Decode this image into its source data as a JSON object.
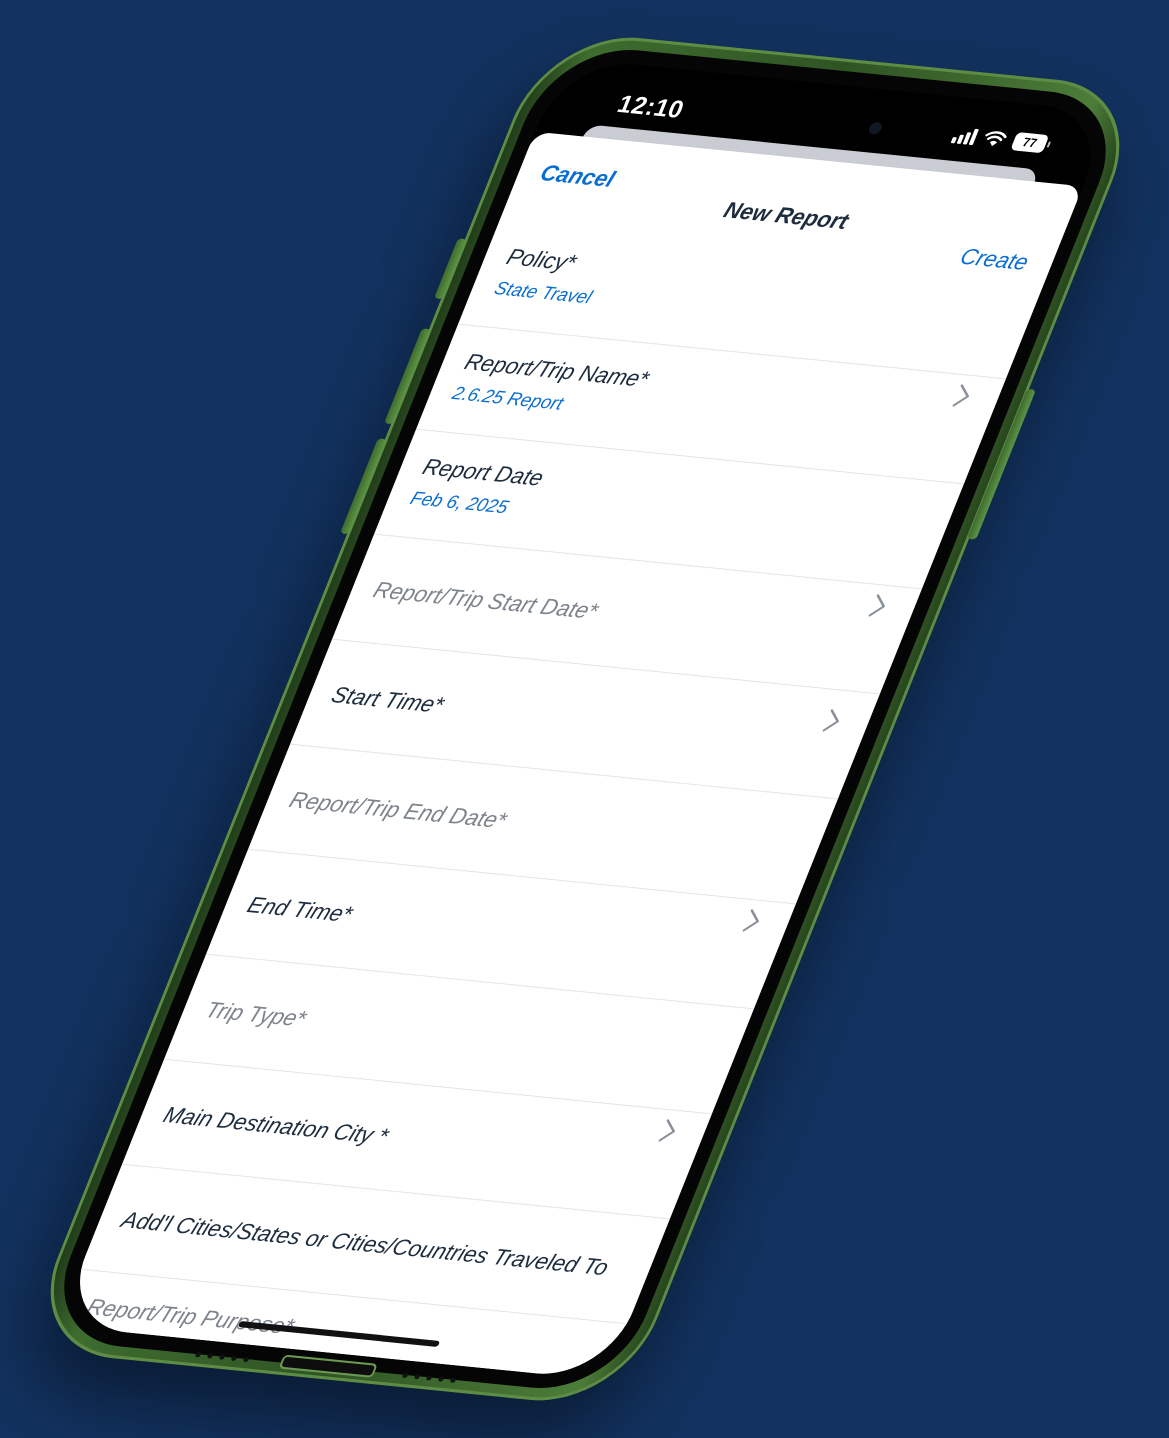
{
  "status_bar": {
    "time": "12:10",
    "battery": "77",
    "signal_icon": "cellular-signal-icon",
    "wifi_icon": "wifi-icon",
    "battery_icon": "battery-icon"
  },
  "navbar": {
    "cancel_label": "Cancel",
    "title": "New Report",
    "create_label": "Create"
  },
  "form": {
    "fields": [
      {
        "label": "Policy*",
        "value": "State Travel",
        "placeholder": false,
        "chevron": false
      },
      {
        "label": "Report/Trip Name*",
        "value": "2.6.25 Report",
        "placeholder": false,
        "chevron": true
      },
      {
        "label": "Report Date",
        "value": "Feb 6, 2025",
        "placeholder": false,
        "chevron": false
      },
      {
        "label": "Report/Trip Start Date*",
        "value": "",
        "placeholder": true,
        "chevron": true
      },
      {
        "label": "Start Time*",
        "value": "",
        "placeholder": false,
        "chevron": true
      },
      {
        "label": "Report/Trip  End Date*",
        "value": "",
        "placeholder": true,
        "chevron": false
      },
      {
        "label": "End Time*",
        "value": "",
        "placeholder": false,
        "chevron": true
      },
      {
        "label": "Trip Type*",
        "value": "",
        "placeholder": true,
        "chevron": false
      },
      {
        "label": "Main Destination City *",
        "value": "",
        "placeholder": false,
        "chevron": true
      },
      {
        "label": "Add'l Cities/States or Cities/Countries Traveled To",
        "value": "",
        "placeholder": false,
        "chevron": false
      },
      {
        "label": "Report/Trip Purpose*",
        "value": "",
        "placeholder": true,
        "chevron": true
      }
    ]
  },
  "colors": {
    "background": "#12325f",
    "phone_frame": "#3e6c2f",
    "link_blue": "#0a6ed1",
    "text_dark": "#1d2d3e",
    "text_placeholder": "#7d848c"
  }
}
